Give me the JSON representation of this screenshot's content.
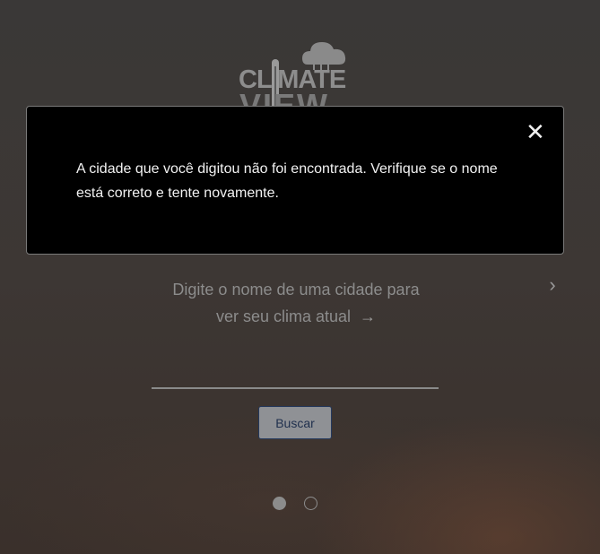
{
  "logo": {
    "line1": "CL  MATE",
    "line2": "VIEW"
  },
  "prompt": {
    "line1": "Digite o nome de uma cidade para",
    "line2": "ver seu clima atual",
    "arrow": "→"
  },
  "next": {
    "glyph": "›"
  },
  "search": {
    "value": "",
    "placeholder": "",
    "button_label": "Buscar"
  },
  "pagination": {
    "total": 2,
    "current": 1
  },
  "modal": {
    "close_glyph": "✕",
    "message": "A cidade que você digitou não foi encontrada. Verifique se o nome está correto e tente novamente."
  },
  "colors": {
    "modal_background": "#000000",
    "button_background": "#8f9195",
    "button_text": "#1f2f4d"
  }
}
